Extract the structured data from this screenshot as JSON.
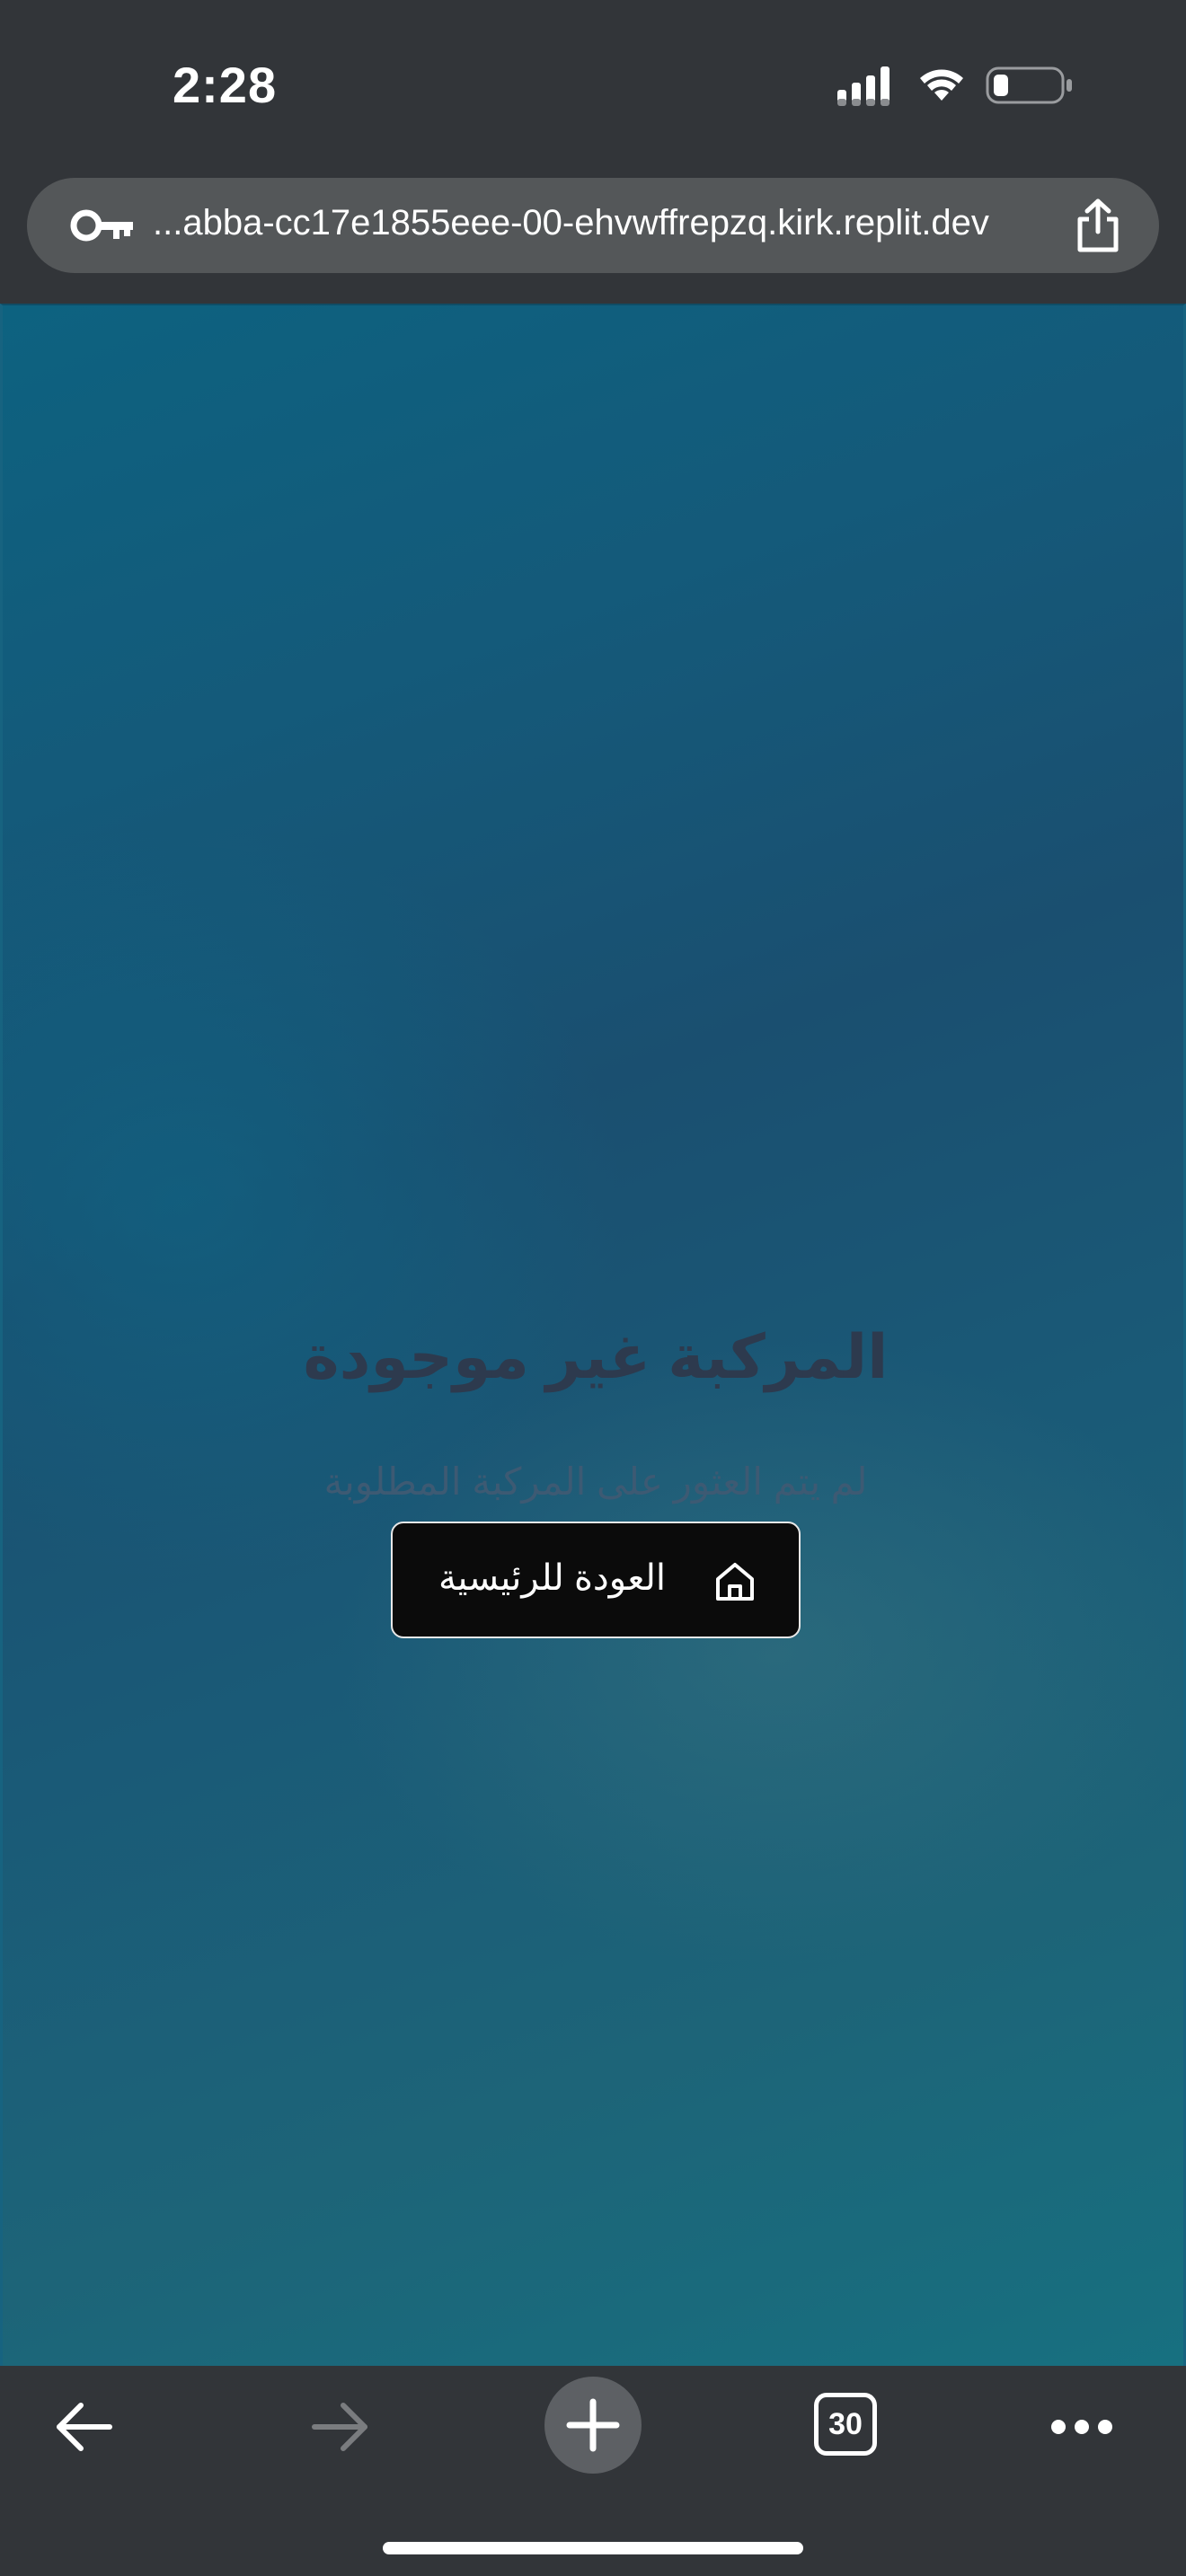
{
  "status_bar": {
    "time": "2:28"
  },
  "browser": {
    "url": "...abba-cc17e1855eee-00-ehvwffrepzq.kirk.replit.dev",
    "open_tab_count": "30"
  },
  "page": {
    "title": "المركبة غير موجودة",
    "subtitle": "لم يتم العثور على المركبة المطلوبة",
    "home_button_label": "العودة للرئيسية"
  },
  "colors": {
    "chrome_background": "#323539",
    "url_bar_background": "#545759",
    "page_gradient_start": "#0d6280",
    "page_gradient_end": "#177080",
    "button_background": "#0b0b0b",
    "title_color": "#2d3a4e"
  },
  "icons": {
    "signal": "cellular-signal-icon",
    "wifi": "wifi-icon",
    "battery": "battery-low-icon",
    "key": "key-icon",
    "share": "share-icon",
    "home": "home-icon",
    "back": "back-arrow-icon",
    "forward": "forward-arrow-icon",
    "new_tab": "plus-icon",
    "tabs": "tabs-icon",
    "more": "more-dots-icon"
  }
}
